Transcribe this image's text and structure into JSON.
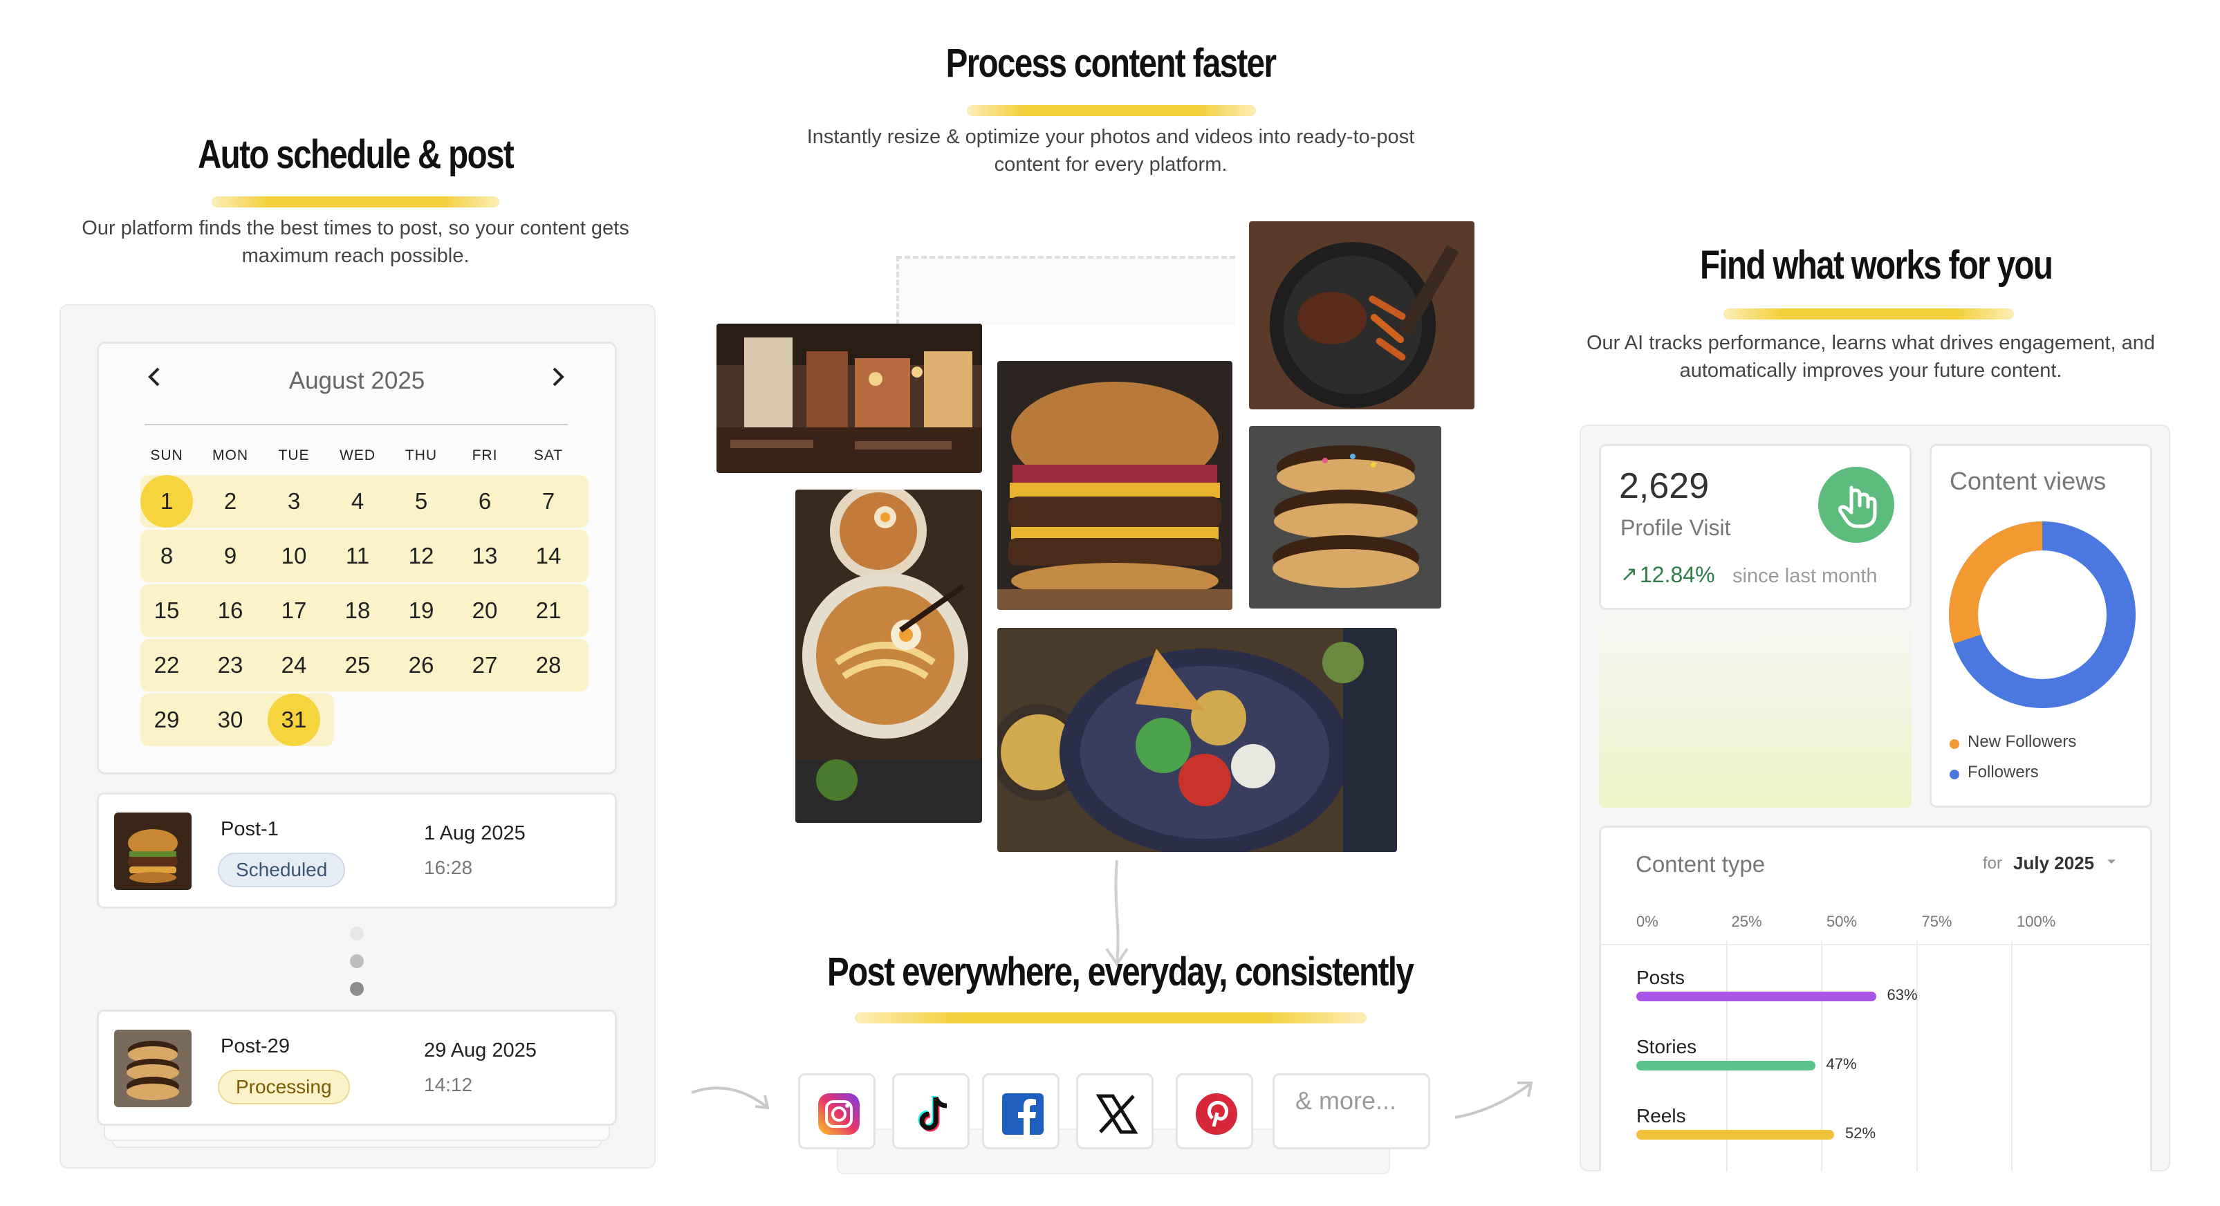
{
  "schedule": {
    "title": "Auto schedule &  post",
    "subtitle_line1": "Our platform finds the best times to post, so your content gets",
    "subtitle_line2": "maximum reach possible.",
    "calendar": {
      "month": "August 2025",
      "prev_icon": "chevron-left-icon",
      "next_icon": "chevron-right-icon",
      "weekdays": [
        "SUN",
        "MON",
        "TUE",
        "WED",
        "THU",
        "FRI",
        "SAT"
      ],
      "weeks": [
        [
          "1",
          "2",
          "3",
          "4",
          "5",
          "6",
          "7"
        ],
        [
          "8",
          "9",
          "10",
          "11",
          "12",
          "13",
          "14"
        ],
        [
          "15",
          "16",
          "17",
          "18",
          "19",
          "20",
          "21"
        ],
        [
          "22",
          "23",
          "24",
          "25",
          "26",
          "27",
          "28"
        ],
        [
          "29",
          "30",
          "31"
        ]
      ],
      "highlighted": [
        "1",
        "31"
      ],
      "highlight_color": "#f6d43d",
      "week_bg_color": "#fbf2c9"
    },
    "posts": [
      {
        "title": "Post-1",
        "status": "Scheduled",
        "date": "1 Aug 2025",
        "time": "16:28",
        "thumb": "burger-thumbnail"
      },
      {
        "title": "Post-29",
        "status": "Processing",
        "date": "29 Aug 2025",
        "time": "14:12",
        "thumb": "donuts-thumbnail"
      }
    ]
  },
  "process": {
    "title": "Process content faster",
    "subtitle_line1": "Instantly resize & optimize your photos and videos into ready-to-post",
    "subtitle_line2": "content for every platform.",
    "photos": [
      "restaurant-interior-photo",
      "burger-photo",
      "steak-pan-photo",
      "donuts-photo",
      "ramen-photo",
      "salad-bowl-photo"
    ]
  },
  "post_everywhere": {
    "title": "Post everywhere, everyday, consistently",
    "platforms": [
      "instagram-icon",
      "tiktok-icon",
      "facebook-icon",
      "x-icon",
      "pinterest-icon"
    ],
    "more_label": "& more..."
  },
  "insights": {
    "title": "Find what works for you",
    "subtitle_line1": "Our AI tracks performance, learns what drives engagement, and",
    "subtitle_line2": "automatically improves your future content.",
    "profile": {
      "value": "2,629",
      "label": "Profile Visit",
      "change": "12.84%",
      "change_suffix": "since last month",
      "icon": "pointer-hand-icon",
      "accent": "#5dbb7e"
    },
    "views": {
      "title": "Content views",
      "legend": [
        {
          "name": "New Followers",
          "color": "#f29a31",
          "share": 0.3
        },
        {
          "name": "Followers",
          "color": "#4a78e0",
          "share": 0.7
        }
      ]
    },
    "content_type": {
      "title": "Content type",
      "filter_prefix": "for",
      "filter_value": "July 2025",
      "ticks": [
        "0%",
        "25%",
        "50%",
        "75%",
        "100%"
      ],
      "bars": [
        {
          "label": "Posts",
          "value": 63,
          "display": "63%",
          "color": "#a855e6"
        },
        {
          "label": "Stories",
          "value": 47,
          "display": "47%",
          "color": "#5cc48a"
        },
        {
          "label": "Reels",
          "value": 52,
          "display": "52%",
          "color": "#f2c13a"
        }
      ]
    }
  }
}
